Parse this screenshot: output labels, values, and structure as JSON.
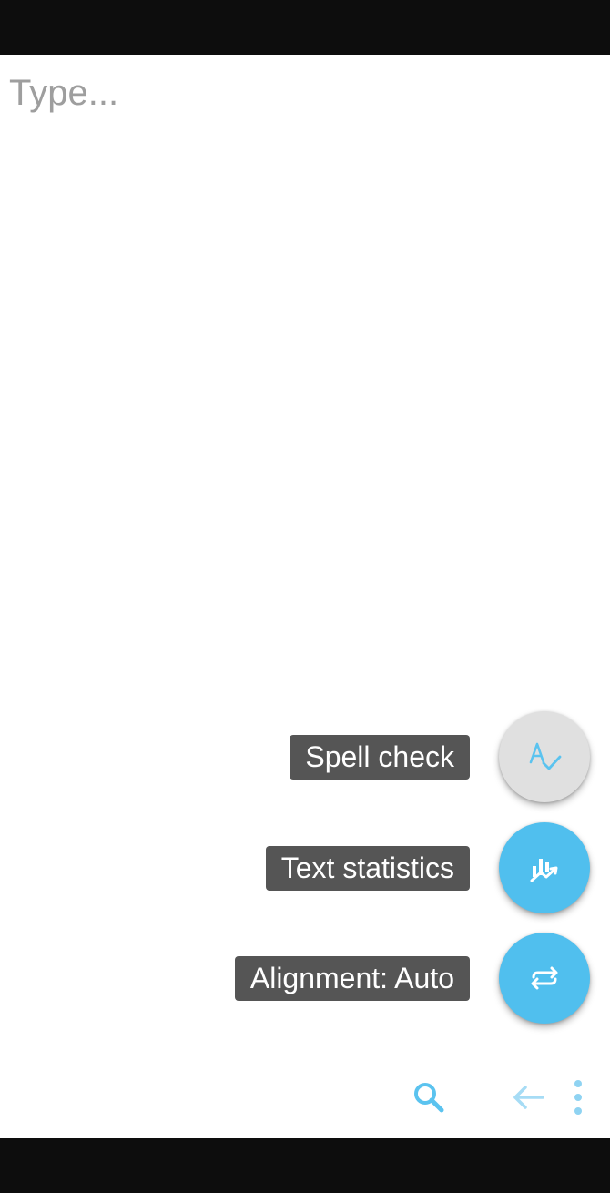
{
  "editor": {
    "placeholder": "Type...",
    "value": ""
  },
  "fab_menu": [
    {
      "label": "Spell check",
      "icon": "spell-check-icon",
      "bg": "#e0e0e0",
      "fg": "#5bc3ef",
      "state": "disabled"
    },
    {
      "label": "Text statistics",
      "icon": "chart-icon",
      "bg": "#50bfee",
      "fg": "#ffffff"
    },
    {
      "label": "Alignment: Auto",
      "icon": "swap-icon",
      "bg": "#50bfee",
      "fg": "#ffffff"
    }
  ],
  "toolbar": {
    "icons": [
      "search-icon",
      "undo-arrow-icon",
      "more-vert-icon"
    ],
    "icon_color": "#5bc3ef",
    "undo_color": "#a6dcf5"
  },
  "colors": {
    "accent": "#50bfee",
    "system_bars": "#0d0d0d"
  }
}
